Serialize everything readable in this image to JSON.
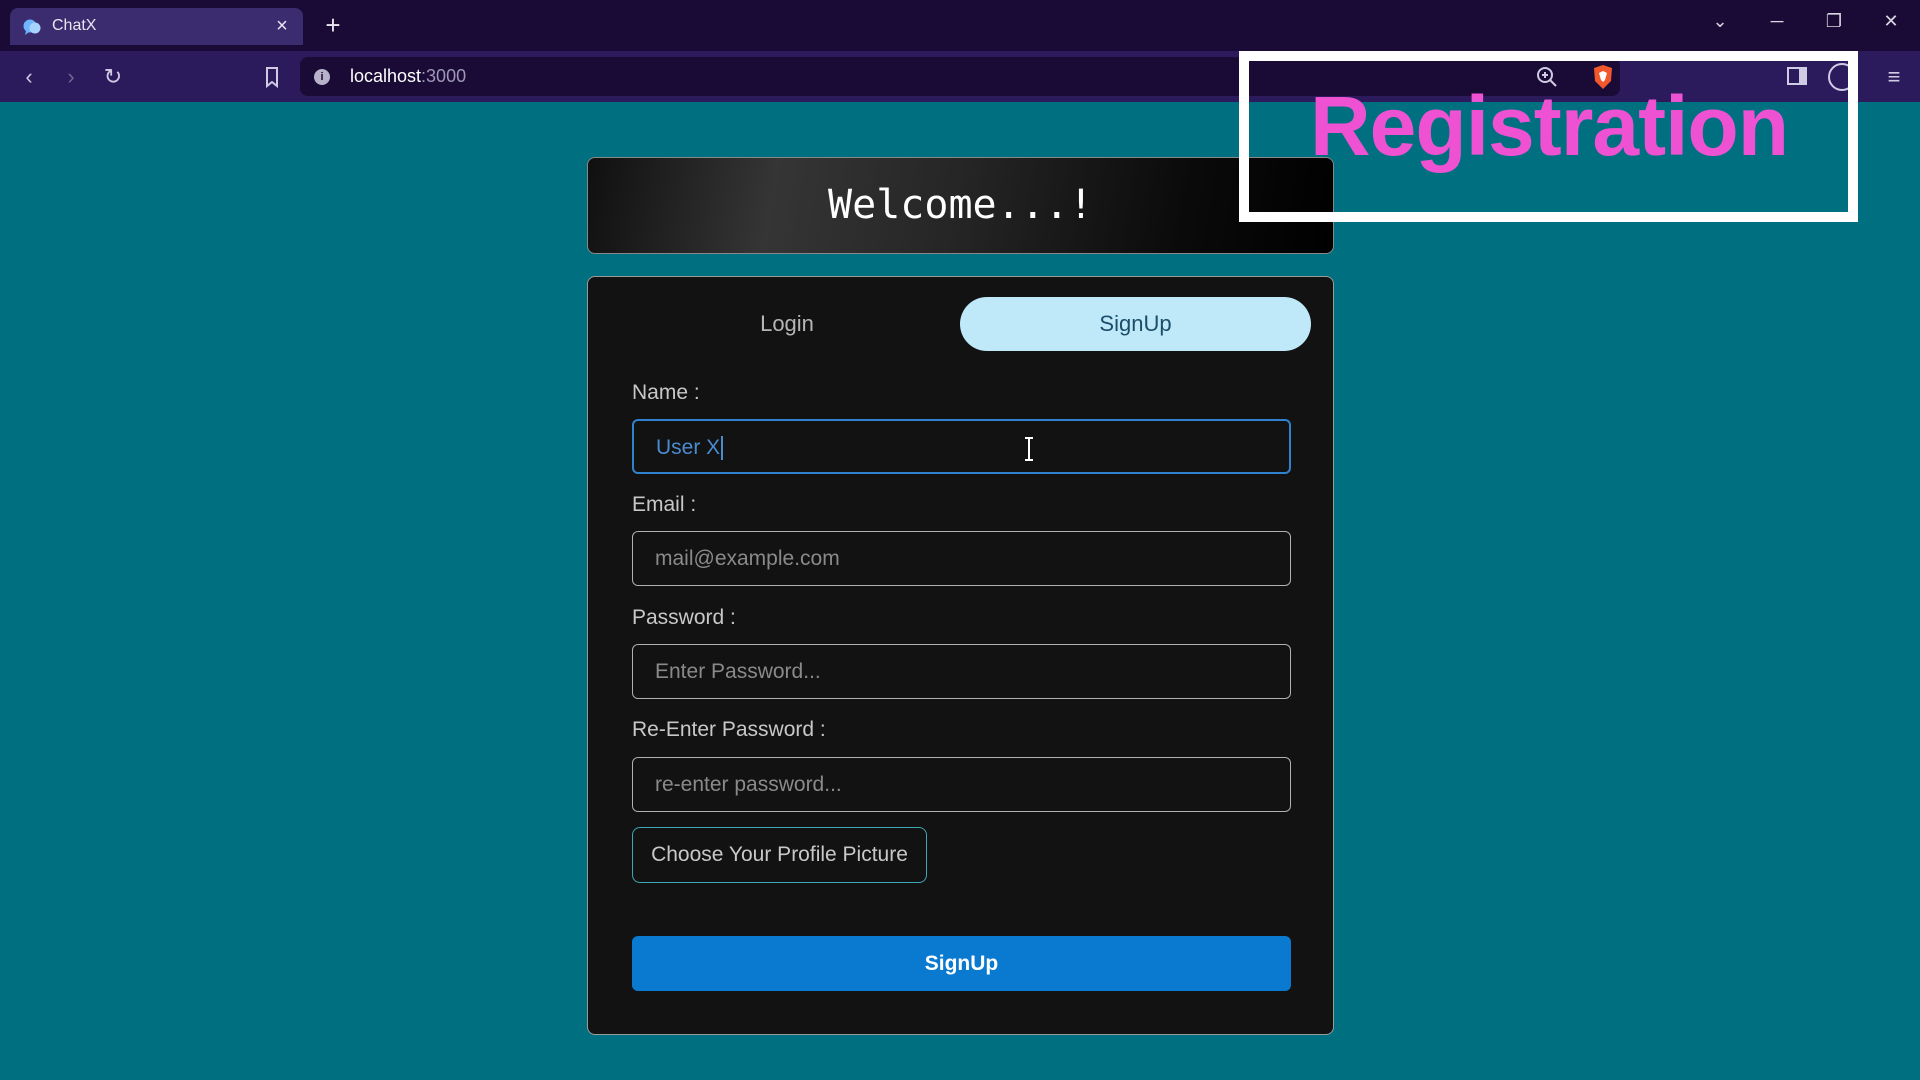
{
  "browser": {
    "tab_title": "ChatX",
    "tab_close": "×",
    "new_tab": "+",
    "url_host": "localhost",
    "url_port": ":3000",
    "info_glyph": "i",
    "menu_glyph": "≡",
    "back_glyph": "‹",
    "forward_glyph": "›",
    "reload_glyph": "↻",
    "tab_list_glyph": "⌄",
    "minimize_glyph": "─",
    "restore_glyph": "❐",
    "close_glyph": "✕",
    "theme_color": "#1a0b36"
  },
  "page": {
    "background": "#007080",
    "welcome": "Welcome...!",
    "tabs": {
      "login": "Login",
      "signup": "SignUp",
      "active": "signup"
    },
    "form": {
      "name_label": "Name :",
      "name_value": "User X",
      "email_label": "Email :",
      "email_placeholder": "mail@example.com",
      "password_label": "Password :",
      "password_placeholder": "Enter Password...",
      "repassword_label": "Re-Enter Password :",
      "repassword_placeholder": "re-enter password...",
      "file_button": "Choose Your Profile Picture",
      "submit": "SignUp"
    },
    "accent": "#0a7ad1"
  },
  "overlay": {
    "text": "Registration",
    "color": "#ee52d2"
  }
}
